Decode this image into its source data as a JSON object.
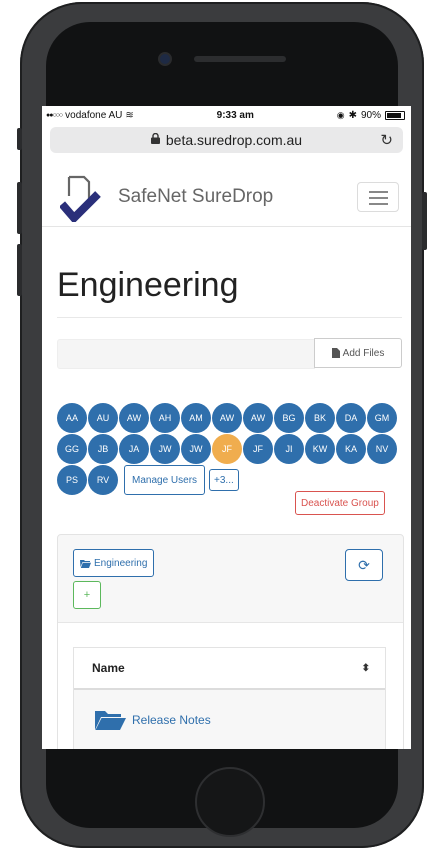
{
  "status_bar": {
    "carrier": "vodafone AU",
    "time": "9:33 am",
    "battery": "90%"
  },
  "browser": {
    "url": "beta.suredrop.com.au"
  },
  "navbar": {
    "brand": "SafeNet SureDrop"
  },
  "page": {
    "title": "Engineering"
  },
  "upload": {
    "add_files_label": "Add Files"
  },
  "users": {
    "rows": [
      [
        "AA",
        "AU",
        "AW",
        "AH",
        "AM",
        "AW",
        "AW",
        "BG",
        "BK",
        "DA",
        "GM"
      ],
      [
        "GG",
        "JB",
        "JA",
        "JW",
        "JW",
        "JF",
        "JF",
        "JI",
        "KW",
        "KA",
        "NV"
      ],
      [
        "PS",
        "RV"
      ]
    ],
    "highlighted": "JF",
    "manage_label": "Manage Users",
    "more_label": "+3..."
  },
  "group": {
    "deactivate_label": "Deactivate Group"
  },
  "folder_panel": {
    "breadcrumb_label": "Engineering",
    "add_label": "+",
    "table": {
      "header_name": "Name",
      "rows": [
        {
          "name": "Release Notes"
        }
      ]
    }
  },
  "colors": {
    "primary": "#2f6fac",
    "highlight": "#f0ad4e",
    "danger": "#d9534f",
    "success": "#5cb85c"
  }
}
